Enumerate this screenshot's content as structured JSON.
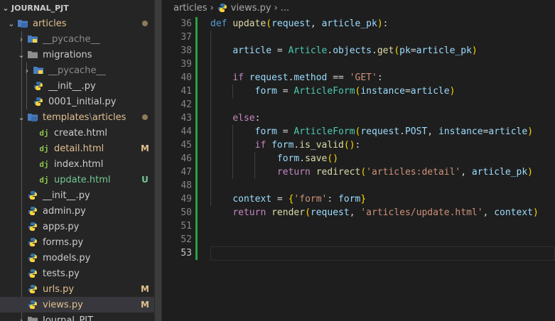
{
  "explorer": {
    "root_label": "JOURNAL_PJT",
    "items": [
      {
        "label": "articles",
        "badge": "",
        "color": "#e2c08d"
      },
      {
        "label": "__pycache__",
        "badge": "",
        "color": "#8b8b8b"
      },
      {
        "label": "migrations",
        "badge": "",
        "color": "#cccccc"
      },
      {
        "label": "__pycache__",
        "badge": "",
        "color": "#8b8b8b"
      },
      {
        "label": "__init__.py",
        "badge": "",
        "color": "#cccccc"
      },
      {
        "label": "0001_initial.py",
        "badge": "",
        "color": "#cccccc"
      },
      {
        "label": "templates",
        "sep": "\\",
        "label2": "articles",
        "badge": "",
        "color": "#e2c08d"
      },
      {
        "label": "create.html",
        "badge": "",
        "color": "#cccccc"
      },
      {
        "label": "detail.html",
        "badge": "M",
        "color": "#e2c08d"
      },
      {
        "label": "index.html",
        "badge": "",
        "color": "#cccccc"
      },
      {
        "label": "update.html",
        "badge": "U",
        "color": "#73c991"
      },
      {
        "label": "__init__.py",
        "badge": "",
        "color": "#cccccc"
      },
      {
        "label": "admin.py",
        "badge": "",
        "color": "#cccccc"
      },
      {
        "label": "apps.py",
        "badge": "",
        "color": "#cccccc"
      },
      {
        "label": "forms.py",
        "badge": "",
        "color": "#cccccc"
      },
      {
        "label": "models.py",
        "badge": "",
        "color": "#cccccc"
      },
      {
        "label": "tests.py",
        "badge": "",
        "color": "#cccccc"
      },
      {
        "label": "urls.py",
        "badge": "M",
        "color": "#e2c08d"
      },
      {
        "label": "views.py",
        "badge": "M",
        "color": "#e2c08d"
      },
      {
        "label": "Journal_PJT",
        "badge": "",
        "color": "#cccccc"
      }
    ]
  },
  "breadcrumb": {
    "folder": "articles",
    "file": "views.py",
    "more": "..."
  },
  "editor": {
    "line_numbers": [
      "36",
      "37",
      "38",
      "39",
      "40",
      "41",
      "42",
      "43",
      "44",
      "45",
      "46",
      "47",
      "48",
      "49",
      "50",
      "51",
      "52",
      "53"
    ],
    "current_line": "53"
  }
}
